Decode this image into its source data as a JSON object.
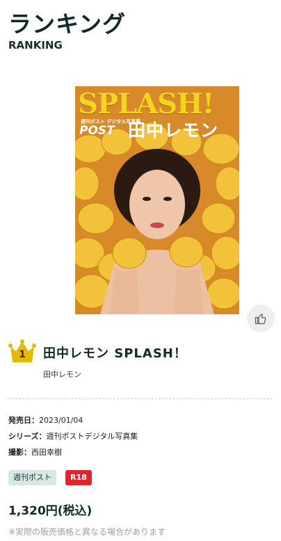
{
  "header": {
    "title": "ランキング",
    "subtitle": "RANKING"
  },
  "cover": {
    "title": "SPLASH!",
    "sub": "週刊ポスト デジタル写真集",
    "brand": "POST",
    "name": "田中レモン"
  },
  "product": {
    "rank": "1",
    "title": "田中レモン SPLASH！",
    "author": "田中レモン",
    "release_label": "発売日：",
    "release_value": "2023/01/04",
    "series_label": "シリーズ：",
    "series_value": "週刊ポストデジタル写真集",
    "photo_label": "撮影：",
    "photo_value": "西田幸樹",
    "tags": [
      "週刊ポスト",
      "R18"
    ],
    "price": "1,320円(税込)",
    "note": "※実際の販売価格と異なる場合があります"
  },
  "colors": {
    "crown": "#e6b800",
    "r18": "#e0262b",
    "series_tag": "#d6e8e5"
  }
}
